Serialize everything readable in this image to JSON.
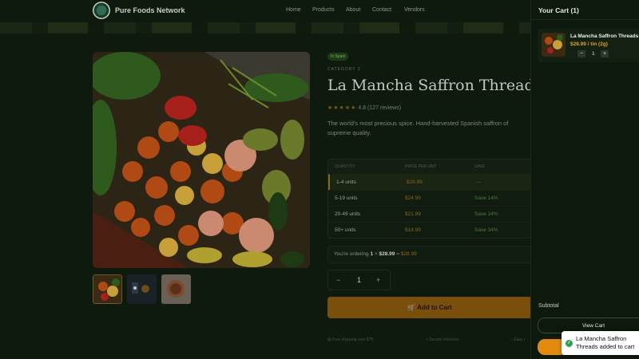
{
  "header": {
    "brand": "Pure Foods Network",
    "nav": [
      "Home",
      "Products",
      "About",
      "Contact",
      "Vendors"
    ]
  },
  "product": {
    "origin_badge": "In Spain",
    "category": "CATEGORY 3",
    "title": "La Mancha Saffron Threads",
    "stars": "★★★★★",
    "rating": "4.8",
    "reviews": "(127 reviews)",
    "description": "The world's most precious spice. Hand-harvested Spanish saffron of supreme quality.",
    "tier_headers": [
      "QUANTITY",
      "PRICE PER UNIT",
      "SAVE"
    ],
    "tiers": [
      {
        "qty": "1-4 units",
        "price": "$28.99",
        "save": "—"
      },
      {
        "qty": "5-19 units",
        "price": "$24.99",
        "save": "Save 14%"
      },
      {
        "qty": "20-49 units",
        "price": "$21.99",
        "save": "Save 24%"
      },
      {
        "qty": "50+ units",
        "price": "$18.99",
        "save": "Save 34%"
      }
    ],
    "ordering_prefix": "You're ordering",
    "ordering_qty": "1",
    "ordering_mid": "× ",
    "ordering_price": "$28.99",
    "ordering_eq": " = ",
    "ordering_total": "$28.99",
    "quantity": "1",
    "minus": "−",
    "plus": "+",
    "add_to_cart": "Add to Cart",
    "perks": [
      "Free shipping over $75",
      "Secure checkout",
      "Easy r"
    ]
  },
  "cart": {
    "title": "Your Cart (1)",
    "item_name": "La Mancha Saffron Threads",
    "item_price": "$28.99 / tin (2g)",
    "item_qty": "1",
    "minus": "−",
    "plus": "+",
    "subtotal_label": "Subtotal",
    "view_cart": "View Cart"
  },
  "toast": {
    "text": "La Mancha Saffron Threads added to cart"
  },
  "colors": {
    "accent": "#e08a0e",
    "price": "#e0a21c",
    "success": "#2ea04f"
  }
}
